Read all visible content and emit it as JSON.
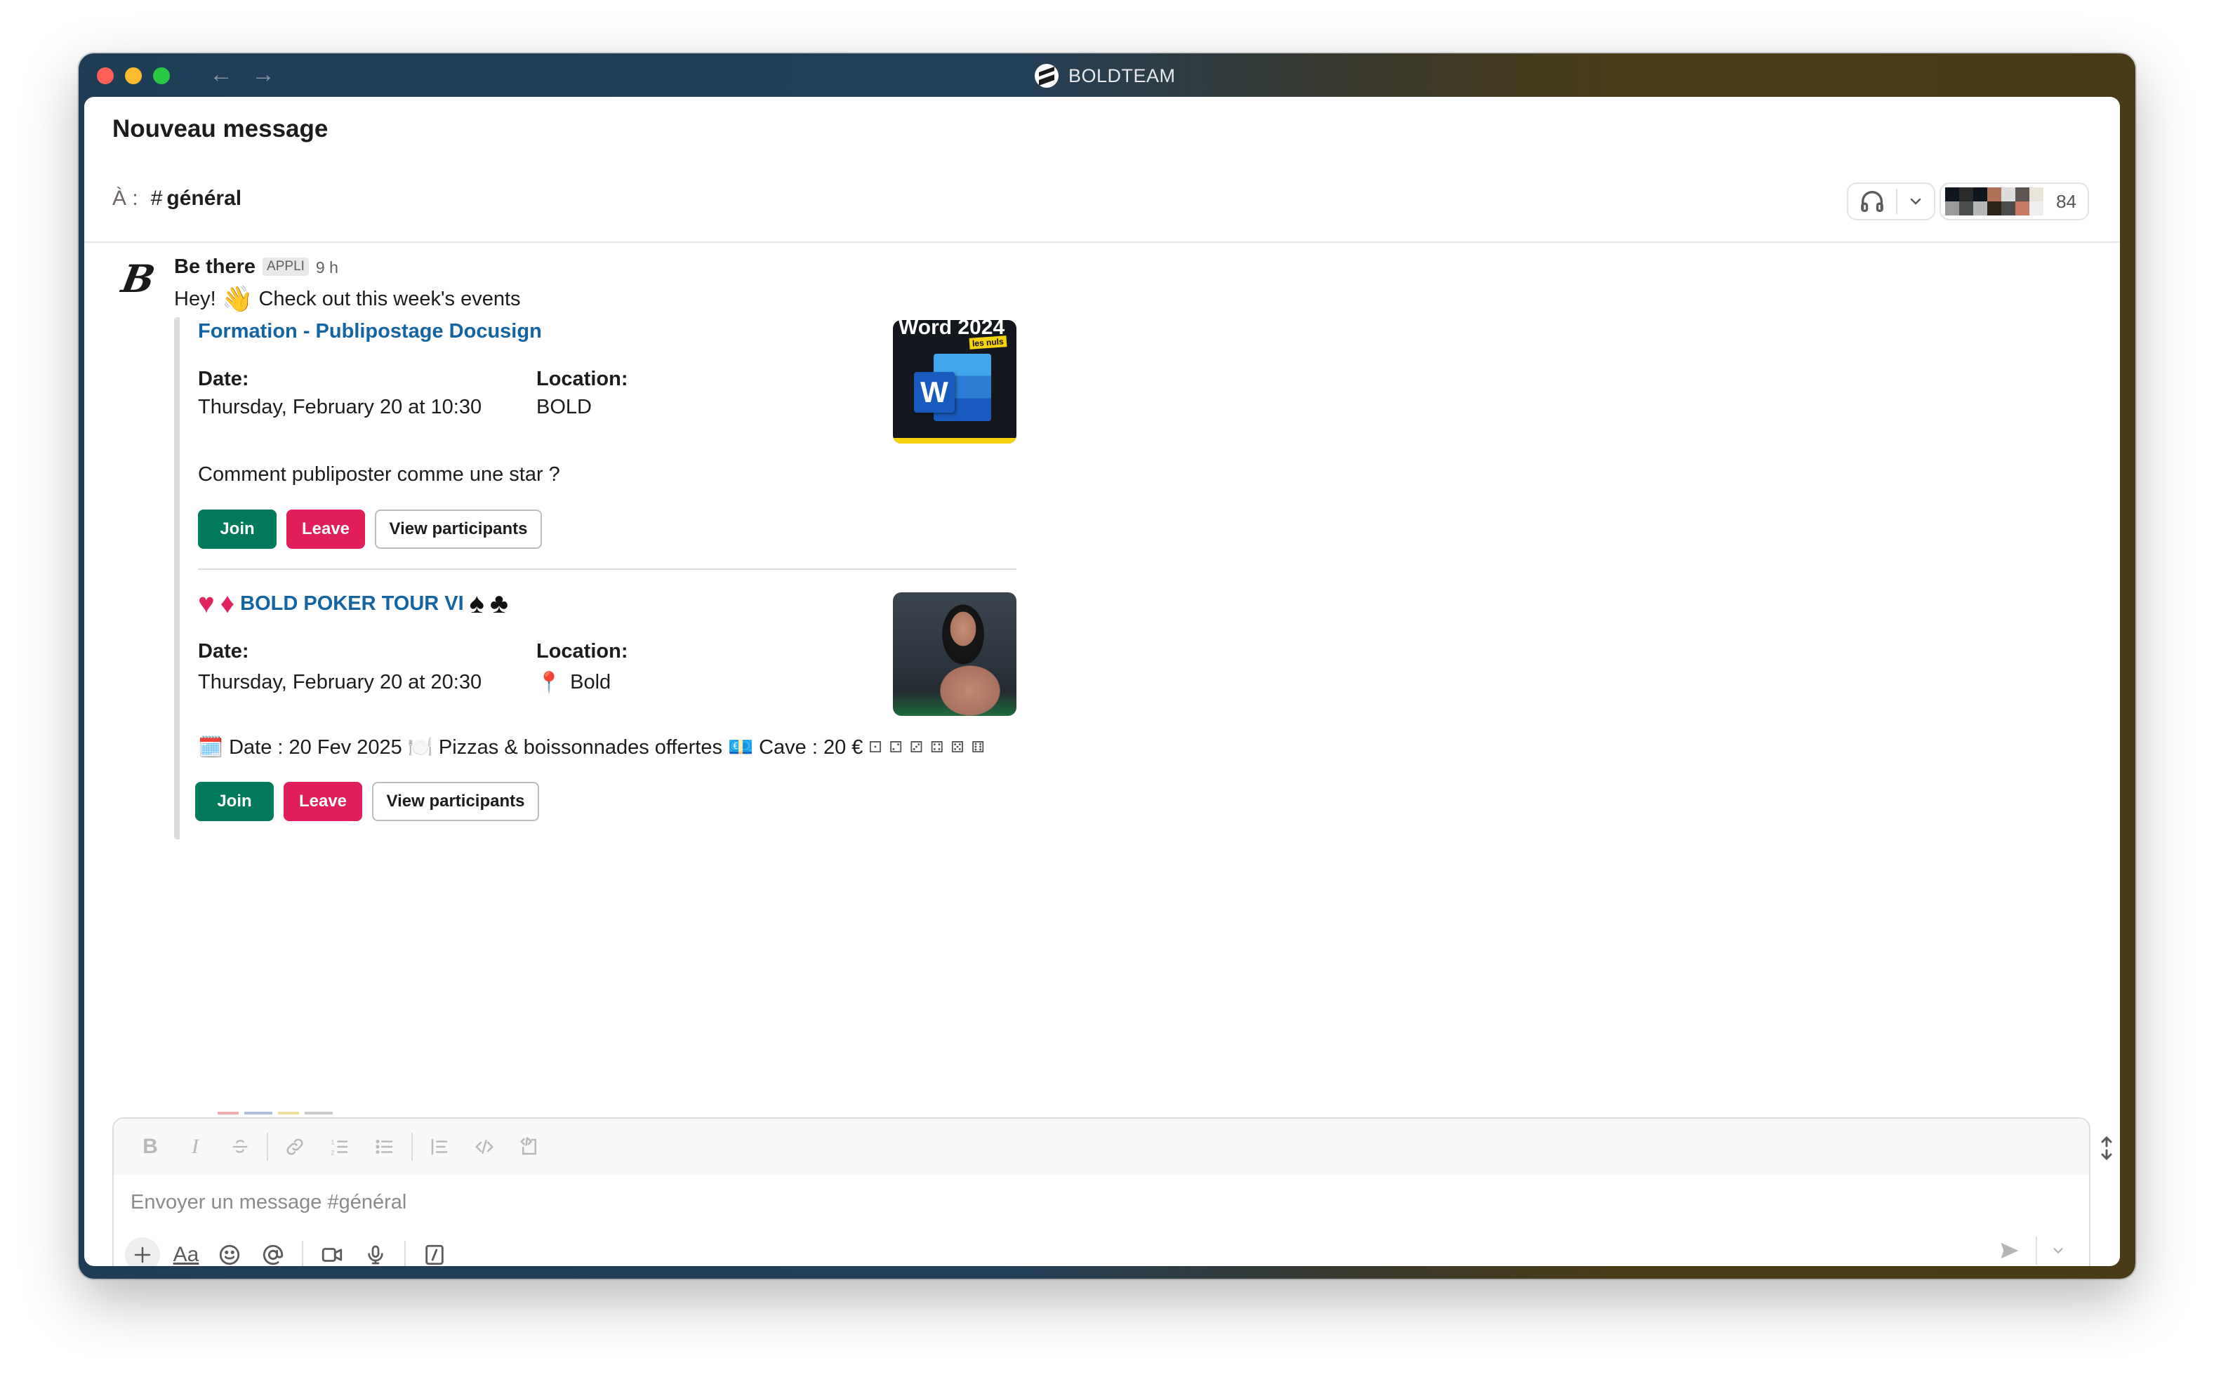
{
  "window": {
    "workspace_name": "BOLDTEAM",
    "nav": {
      "back_icon": "arrow-left-icon",
      "forward_icon": "arrow-right-icon"
    }
  },
  "header": {
    "title": "Nouveau message",
    "to_label": "À :",
    "channel_hash": "#",
    "channel_name": "général",
    "huddle_icon": "headphones-icon",
    "member_count": "84"
  },
  "message": {
    "sender": "Be there",
    "badge": "APPLI",
    "time": "9 h",
    "text_before": "Hey!",
    "wave_emoji": "👋",
    "text_after": "Check out this week's events",
    "events": [
      {
        "title": "Formation - Publipostage Docusign",
        "date_label": "Date:",
        "date_value": "Thursday, February 20 at 10:30",
        "location_label": "Location:",
        "location_value": "BOLD",
        "description": "Comment publiposter comme une star ?",
        "thumbnail": {
          "title": "Word 2024",
          "tag": "les nuls",
          "letter": "W"
        },
        "buttons": {
          "join": "Join",
          "leave": "Leave",
          "view": "View participants"
        }
      },
      {
        "title_prefix": [
          "♥",
          "♦"
        ],
        "title": "BOLD POKER TOUR VI",
        "title_suffix": [
          "♠",
          "♣"
        ],
        "date_label": "Date:",
        "date_value": "Thursday, February 20 at 20:30",
        "location_label": "Location:",
        "location_pin": "📍",
        "location_value": "Bold",
        "description_parts": {
          "calendar_emoji": "🗓️",
          "date_text": "Date : 20 Fev 2025",
          "plate_emoji": "🍽️",
          "food_text": "Pizzas & boissonnades offertes",
          "money_emoji": "💶",
          "cave_text": "Cave : 20 €",
          "dice": "⚀ ⚁ ⚂ ⚃ ⚄ ⚅"
        },
        "buttons": {
          "join": "Join",
          "leave": "Leave",
          "view": "View participants"
        }
      }
    ]
  },
  "composer": {
    "placeholder": "Envoyer un message #général",
    "value": "",
    "format_tools": [
      "bold",
      "italic",
      "strikethrough",
      "link",
      "ordered-list",
      "bulleted-list",
      "blockquote",
      "code",
      "code-block"
    ],
    "actions": [
      "add",
      "formatting",
      "emoji",
      "mention",
      "video",
      "audio",
      "shortcuts"
    ],
    "format_labels": {
      "bold": "B",
      "italic": "I",
      "aa": "Aa"
    }
  },
  "colors": {
    "join": "#007a5a",
    "leave": "#e01e5a",
    "link": "#1264a3"
  }
}
